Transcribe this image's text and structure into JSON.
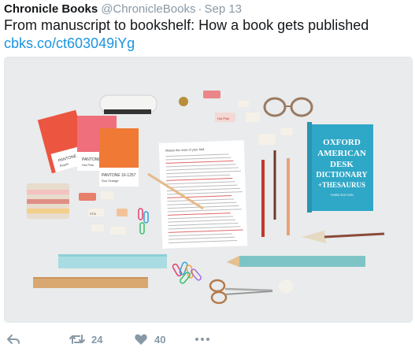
{
  "tweet": {
    "author": "Chronicle Books",
    "handle": "@ChronicleBooks",
    "separator": "·",
    "date": "Sep 13",
    "text": "From manuscript to bookshelf: How a book gets published",
    "link": "cbks.co/ct603049iYg"
  },
  "media": {
    "pantone_1_brand": "PANTONE",
    "pantone_1_name": "Peach",
    "pantone_2_brand": "PANTONE",
    "pantone_2_name": "Hot Pink",
    "pantone_3_brand": "PANTONE 16-1257",
    "pantone_3_name": "Sun Orange",
    "manuscript_title": "Makes the most of your bed",
    "dictionary_line1": "OXFORD",
    "dictionary_line2": "AMERICAN",
    "dictionary_line3": "DESK",
    "dictionary_line4": "DICTIONARY",
    "dictionary_line5": "+THESAURUS",
    "dictionary_edition": "THIRD EDITION",
    "eraser_label_1": "Hot Pink",
    "eraser_label_2": "STB",
    "colors": {
      "background": "#e9ebec",
      "peach": "#ec5540",
      "hot_pink": "#ef6f7c",
      "sun_orange": "#f07a35",
      "dictionary": "#2fa7c7",
      "ruler_blue": "#7fc8d0",
      "ruler_wood": "#d9a870"
    }
  },
  "actions": {
    "reply_icon": "reply-icon",
    "retweet_icon": "retweet-icon",
    "retweet_count": "24",
    "like_icon": "heart-icon",
    "like_count": "40",
    "more_icon": "more-icon"
  }
}
